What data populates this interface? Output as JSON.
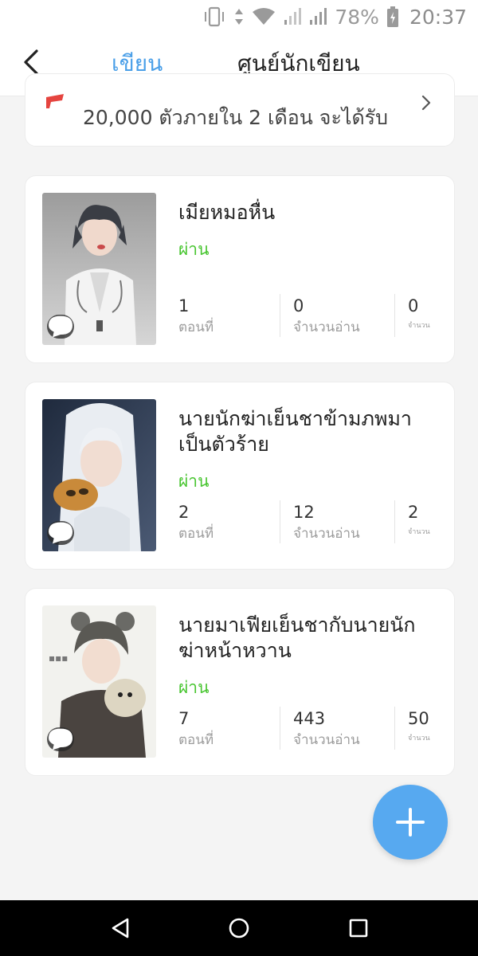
{
  "status_bar": {
    "battery": "78%",
    "time": "20:37",
    "icons": [
      "vibrate-icon",
      "data-arrows-icon",
      "wifi-icon",
      "signal-icon",
      "signal-icon",
      "battery-charging-icon"
    ]
  },
  "header": {
    "back_icon": "back-arrow-icon",
    "tabs": [
      {
        "label": "เขียน",
        "active": true
      },
      {
        "label": "ศูนย์นักเขียน",
        "active": false
      }
    ]
  },
  "banner": {
    "text": "20,000 ตัวภายใน 2 เดือน จะได้รับ",
    "icon": "red-flag-icon",
    "chevron": "chevron-right-icon"
  },
  "stories": [
    {
      "title": "เมียหมอหื่น",
      "status": "ผ่าน",
      "stats": [
        {
          "value": "1",
          "label": "ตอนที่"
        },
        {
          "value": "0",
          "label": "จำนวนอ่าน"
        },
        {
          "value": "0",
          "label": "จำนวน"
        }
      ]
    },
    {
      "title": "นายนักฆ่าเย็นชาข้ามภพมาเป็นตัวร้าย",
      "status": "ผ่าน",
      "stats": [
        {
          "value": "2",
          "label": "ตอนที่"
        },
        {
          "value": "12",
          "label": "จำนวนอ่าน"
        },
        {
          "value": "2",
          "label": "จำนวน"
        }
      ]
    },
    {
      "title": "นายมาเฟียเย็นชากับนายนักฆ่าหน้าหวาน",
      "status": "ผ่าน",
      "stats": [
        {
          "value": "7",
          "label": "ตอนที่"
        },
        {
          "value": "443",
          "label": "จำนวนอ่าน"
        },
        {
          "value": "50",
          "label": "จำนวน"
        }
      ]
    }
  ],
  "fab": {
    "icon": "plus-icon"
  },
  "nav_bar": {
    "icons": [
      "back-triangle-icon",
      "home-circle-icon",
      "recents-square-icon"
    ]
  },
  "colors": {
    "accent": "#4a9fe8",
    "status_green": "#47c52f",
    "fab": "#57a9f0",
    "background": "#f4f4f4"
  }
}
